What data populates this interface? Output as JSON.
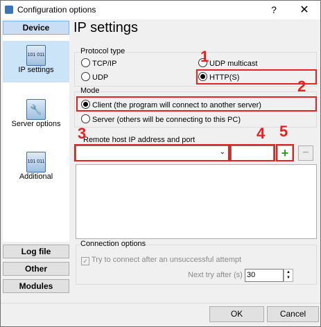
{
  "window": {
    "title": "Configuration options",
    "help_glyph": "?",
    "close_glyph": "✕"
  },
  "left": {
    "device": "Device",
    "nav": [
      {
        "label": "IP settings",
        "icon": "ip-settings-icon",
        "icon_text": "101 011"
      },
      {
        "label": "Server options",
        "icon": "wrench-icon",
        "icon_text": ""
      },
      {
        "label": "Additional",
        "icon": "additional-settings-icon",
        "icon_text": "101 011"
      }
    ],
    "log_file": "Log file",
    "other": "Other",
    "modules": "Modules"
  },
  "main": {
    "heading": "IP settings",
    "protocol": {
      "label": "Protocol type",
      "options": [
        "TCP/IP",
        "UDP multicast",
        "UDP",
        "HTTP(S)"
      ],
      "selected": "HTTP(S)"
    },
    "mode": {
      "label": "Mode",
      "client": "Client (the program will connect to another server)",
      "server": "Server (others will be connecting to this PC)",
      "selected": "client"
    },
    "remote": {
      "label": "Remote host IP address and port",
      "host_value": "",
      "port_value": "",
      "add_glyph": "+",
      "remove_glyph": "−"
    },
    "connection": {
      "label": "Connection options",
      "retry_label": "Try to connect after an unsuccessful attempt",
      "retry_checked": true,
      "next_try_label": "Next try after (s)",
      "next_try_value": "30"
    }
  },
  "annotations": {
    "n1": "1",
    "n2": "2",
    "n3": "3",
    "n4": "4",
    "n5": "5",
    "color": "#e52121"
  },
  "footer": {
    "ok": "OK",
    "cancel": "Cancel"
  }
}
